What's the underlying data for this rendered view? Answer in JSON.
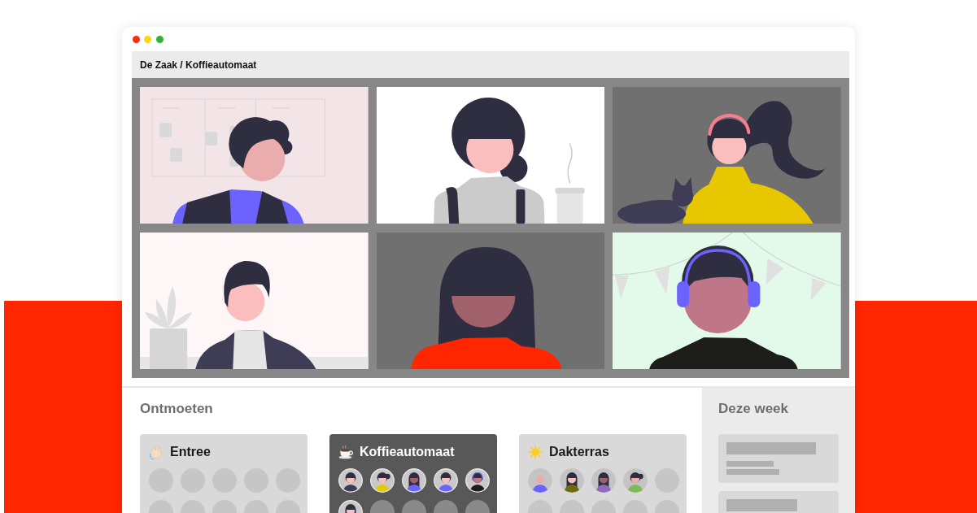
{
  "window": {
    "breadcrumb": "De Zaak / Koffieautomaat"
  },
  "meet": {
    "title": "Ontmoeten",
    "rooms": [
      {
        "name": "Entree",
        "selected": false,
        "seats": [
          {
            "occupied": false
          },
          {
            "occupied": false
          },
          {
            "occupied": false
          },
          {
            "occupied": false
          },
          {
            "occupied": false
          },
          {
            "occupied": false
          },
          {
            "occupied": false
          },
          {
            "occupied": false
          },
          {
            "occupied": false
          },
          {
            "occupied": false
          }
        ]
      },
      {
        "name": "Koffieautomaat",
        "selected": true,
        "seats": [
          {
            "occupied": true
          },
          {
            "occupied": true
          },
          {
            "occupied": true
          },
          {
            "occupied": true
          },
          {
            "occupied": true
          },
          {
            "occupied": true
          },
          {
            "occupied": false
          },
          {
            "occupied": false
          },
          {
            "occupied": false
          },
          {
            "occupied": false
          }
        ]
      },
      {
        "name": "Dakterras",
        "selected": false,
        "seats": [
          {
            "occupied": true
          },
          {
            "occupied": true
          },
          {
            "occupied": true
          },
          {
            "occupied": true
          },
          {
            "occupied": false
          },
          {
            "occupied": false
          },
          {
            "occupied": false
          },
          {
            "occupied": false
          },
          {
            "occupied": false
          },
          {
            "occupied": false
          }
        ]
      }
    ]
  },
  "sidebar": {
    "title": "Deze week"
  }
}
